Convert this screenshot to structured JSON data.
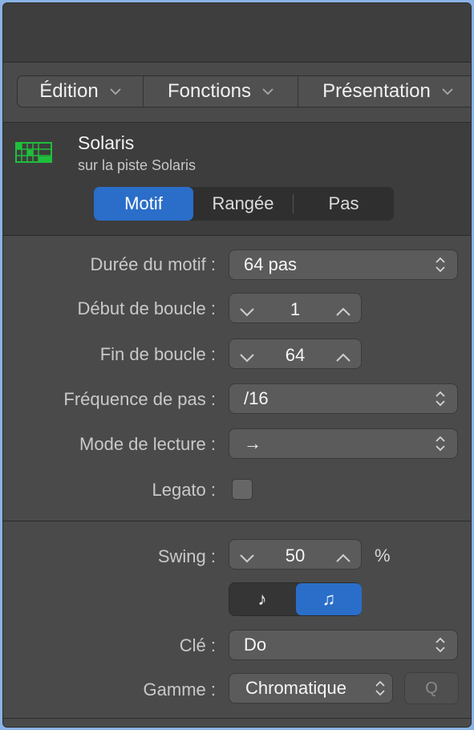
{
  "menubar": {
    "items": [
      {
        "label": "Édition"
      },
      {
        "label": "Fonctions"
      },
      {
        "label": "Présentation"
      }
    ]
  },
  "region": {
    "name": "Solaris",
    "subtitle": "sur la piste Solaris",
    "icon": "step-sequencer-grid-icon",
    "icon_color": "#1fbf3c"
  },
  "segmented": {
    "items": [
      {
        "label": "Motif",
        "selected": true
      },
      {
        "label": "Rangée",
        "selected": false
      },
      {
        "label": "Pas",
        "selected": false
      }
    ]
  },
  "settings": {
    "pattern_length": {
      "label": "Durée du motif :",
      "value": "64 pas"
    },
    "loop_start": {
      "label": "Début de boucle :",
      "value": "1"
    },
    "loop_end": {
      "label": "Fin de boucle :",
      "value": "64"
    },
    "step_rate": {
      "label": "Fréquence de pas :",
      "value": "/16"
    },
    "playback_mode": {
      "label": "Mode de lecture :",
      "value": "→"
    },
    "legato": {
      "label": "Legato :",
      "checked": false
    },
    "swing": {
      "label": "Swing :",
      "value": "50",
      "unit": "%"
    },
    "swing_note": {
      "options": [
        "♪",
        "♫"
      ],
      "selected_index": 1
    },
    "key": {
      "label": "Clé :",
      "value": "Do"
    },
    "scale": {
      "label": "Gamme :",
      "value": "Chromatique"
    },
    "quantize": {
      "label": "Q"
    }
  },
  "colors": {
    "accent": "#2a6ec9",
    "panel": "#4a4a4a",
    "header": "#3d3d3d"
  }
}
